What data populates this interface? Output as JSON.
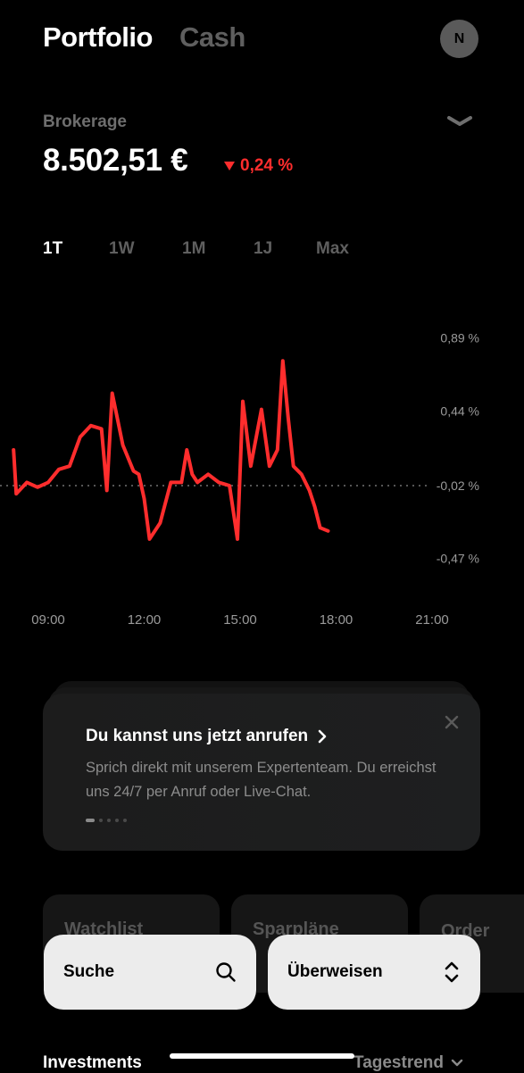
{
  "header": {
    "title": "Portfolio",
    "tab_cash": "Cash",
    "avatar_initial": "N"
  },
  "account": {
    "label": "Brokerage",
    "balance": "8.502,51 €",
    "change": "0,24 %",
    "change_color": "#ff2d2d"
  },
  "ranges": [
    "1T",
    "1W",
    "1M",
    "1J",
    "Max"
  ],
  "chart_data": {
    "type": "line",
    "series": [
      {
        "color": "#ff2d2d",
        "x": [
          "07:55",
          "08:00",
          "08:20",
          "08:40",
          "09:00",
          "09:20",
          "09:40",
          "10:00",
          "10:20",
          "10:40",
          "10:50",
          "11:00",
          "11:20",
          "11:40",
          "11:50",
          "12:00",
          "12:10",
          "12:30",
          "12:50",
          "13:10",
          "13:20",
          "13:30",
          "13:40",
          "14:00",
          "14:20",
          "14:40",
          "14:55",
          "15:05",
          "15:20",
          "15:40",
          "15:55",
          "16:10",
          "16:20",
          "16:30",
          "16:40",
          "16:55",
          "17:10",
          "17:20",
          "17:30",
          "17:45"
        ],
        "values": [
          0.2,
          -0.07,
          0.0,
          -0.03,
          0.0,
          0.08,
          0.1,
          0.28,
          0.35,
          0.33,
          -0.05,
          0.55,
          0.23,
          0.07,
          0.05,
          -0.1,
          -0.35,
          -0.25,
          0.0,
          0.0,
          0.2,
          0.05,
          0.0,
          0.05,
          0.0,
          -0.02,
          -0.35,
          0.5,
          0.1,
          0.45,
          0.1,
          0.2,
          0.75,
          0.4,
          0.1,
          0.05,
          -0.05,
          -0.15,
          -0.28,
          -0.3
        ]
      }
    ],
    "y_ticks": [
      "0,89 %",
      "0,44 %",
      "-0,02 %",
      "-0,47 %"
    ],
    "x_ticks": [
      "09:00",
      "12:00",
      "15:00",
      "18:00",
      "21:00"
    ],
    "baseline": -0.02,
    "ylim": [
      -0.47,
      0.89
    ],
    "grid": false
  },
  "promo": {
    "title": "Du kannst uns jetzt anrufen",
    "text": "Sprich direkt mit unserem Expertenteam. Du erreichst uns 24/7 per Anruf oder Live-Chat."
  },
  "tiles": [
    "Watchlist",
    "Sparpläne",
    "Order"
  ],
  "actions": {
    "search": "Suche",
    "transfer": "Überweisen"
  },
  "footer": {
    "investments": "Investments",
    "trend": "Tagestrend"
  }
}
